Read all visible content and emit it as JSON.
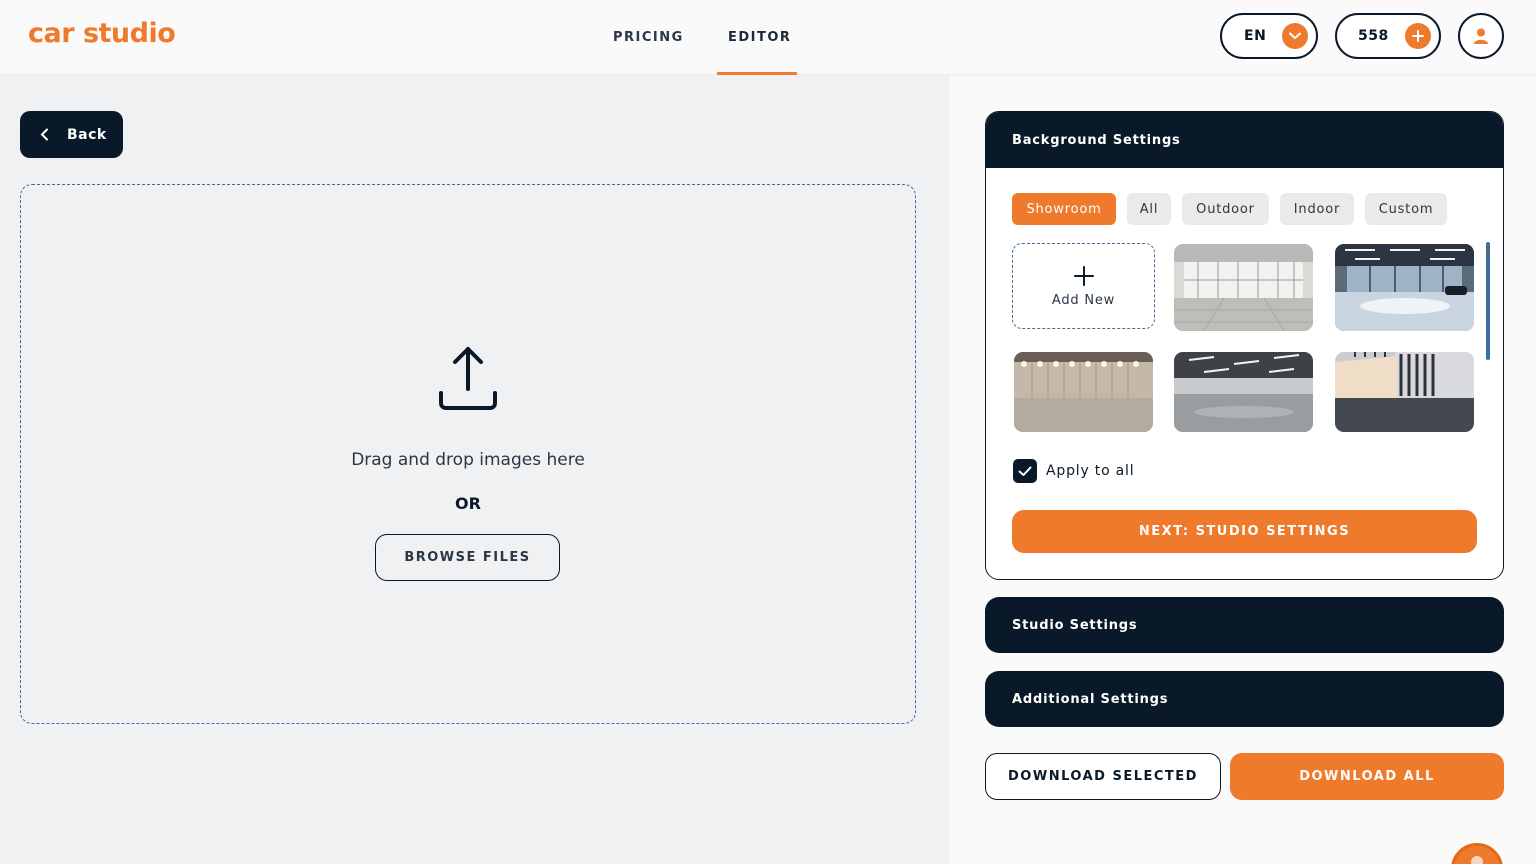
{
  "brand": {
    "logo_text": "car studio",
    "accent": "#f07a2c",
    "dark": "#0a1929"
  },
  "nav": {
    "pricing": "PRICING",
    "editor": "EDITOR",
    "active": "EDITOR"
  },
  "header": {
    "language": "EN",
    "credits": "558"
  },
  "left": {
    "back_label": "Back",
    "dropzone_text": "Drag and drop images here",
    "or_text": "OR",
    "browse_label": "BROWSE FILES"
  },
  "background_settings": {
    "title": "Background Settings",
    "tabs": [
      "Showroom",
      "All",
      "Outdoor",
      "Indoor",
      "Custom"
    ],
    "active_tab": "Showroom",
    "add_new_label": "Add New",
    "thumbnails": [
      "showroom-bright-glass",
      "showroom-blue-floor",
      "showroom-lit-wall",
      "garage-gray-floor",
      "studio-white-wall"
    ],
    "apply_to_all_label": "Apply to all",
    "apply_to_all_checked": true,
    "next_label": "NEXT: STUDIO SETTINGS"
  },
  "sections": {
    "studio": "Studio Settings",
    "additional": "Additional Settings"
  },
  "actions": {
    "download_selected": "DOWNLOAD SELECTED",
    "download_all": "DOWNLOAD ALL"
  }
}
